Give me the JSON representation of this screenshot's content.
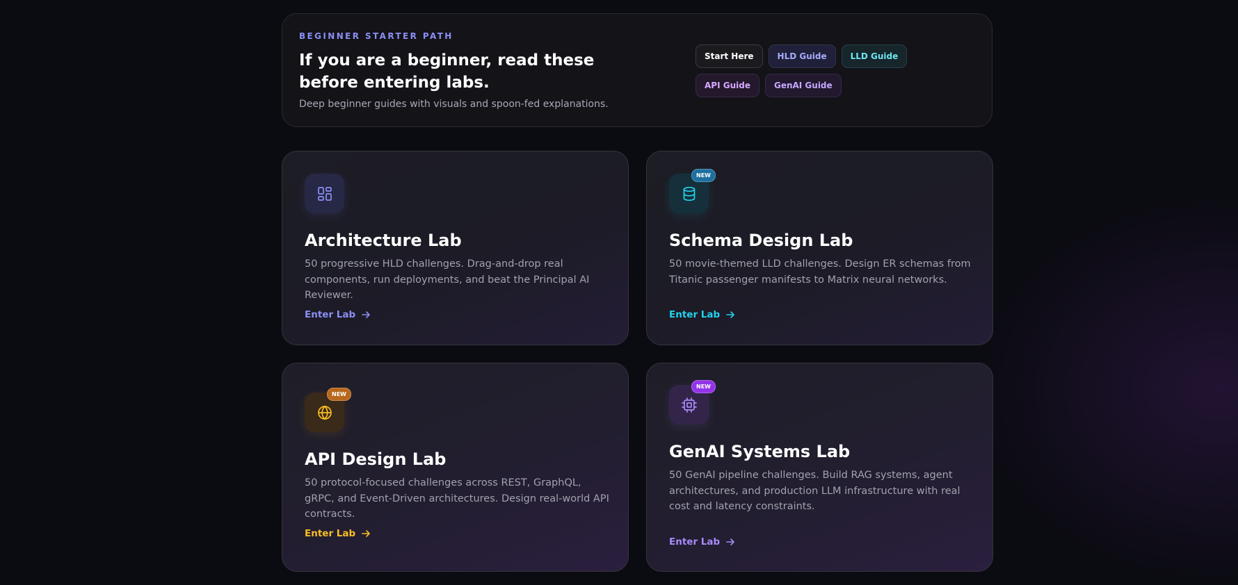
{
  "starter": {
    "eyebrow": "BEGINNER STARTER PATH",
    "title": "If you are a beginner, read these before entering labs.",
    "subtitle": "Deep beginner guides with visuals and spoon-fed explanations.",
    "chips": [
      {
        "label": "Start Here"
      },
      {
        "label": "HLD Guide"
      },
      {
        "label": "LLD Guide"
      },
      {
        "label": "API Guide"
      },
      {
        "label": "GenAI Guide"
      }
    ]
  },
  "labs": [
    {
      "title": "Architecture Lab",
      "description": "50 progressive HLD challenges. Drag-and-drop real components, run deployments, and beat the Principal AI Reviewer.",
      "cta": "Enter Lab",
      "icon": "layout-grid-icon",
      "accent": "#8b8ff5"
    },
    {
      "title": "Schema Design Lab",
      "description": "50 movie-themed LLD challenges. Design ER schemas from Titanic passenger manifests to Matrix neural networks.",
      "cta": "Enter Lab",
      "badge": "NEW",
      "icon": "database-icon",
      "accent": "#22d3ee"
    },
    {
      "title": "API Design Lab",
      "description": "50 protocol-focused challenges across REST, GraphQL, gRPC, and Event-Driven architectures. Design real-world API contracts.",
      "cta": "Enter Lab",
      "badge": "NEW",
      "icon": "globe-icon",
      "accent": "#fbbf24"
    },
    {
      "title": "GenAI Systems Lab",
      "description": "50 GenAI pipeline challenges. Build RAG systems, agent architectures, and production LLM infrastructure with real cost and latency constraints.",
      "cta": "Enter Lab",
      "badge": "NEW",
      "icon": "cpu-chip-icon",
      "accent": "#a78bfa"
    }
  ]
}
